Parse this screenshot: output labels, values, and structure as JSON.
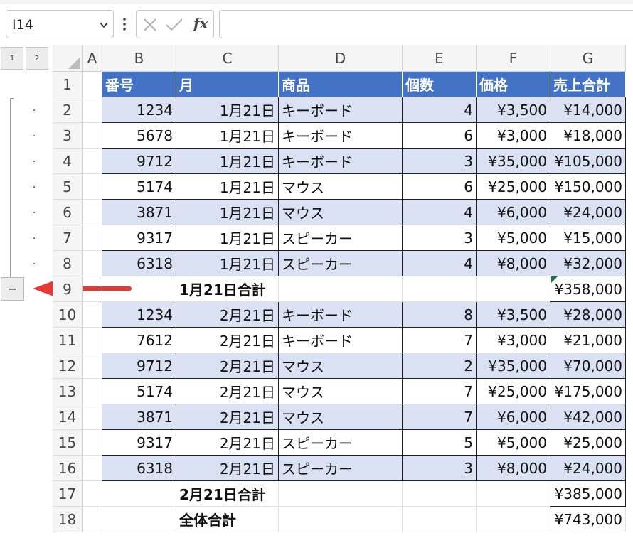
{
  "name_box": {
    "value": "I14"
  },
  "formula_bar": {
    "fx_label": "fx",
    "value": ""
  },
  "outline": {
    "level_buttons": [
      "1",
      "2"
    ],
    "collapse_symbol": "−"
  },
  "columns": [
    "A",
    "B",
    "C",
    "D",
    "E",
    "F",
    "G"
  ],
  "table": {
    "headers": [
      "番号",
      "月",
      "商品",
      "個数",
      "価格",
      "売上合計"
    ],
    "rows": [
      [
        "1234",
        "1月21日",
        "キーボード",
        "4",
        "¥3,500",
        "¥14,000"
      ],
      [
        "5678",
        "1月21日",
        "キーボード",
        "6",
        "¥3,000",
        "¥18,000"
      ],
      [
        "9712",
        "1月21日",
        "キーボード",
        "3",
        "¥35,000",
        "¥105,000"
      ],
      [
        "5174",
        "1月21日",
        "マウス",
        "6",
        "¥25,000",
        "¥150,000"
      ],
      [
        "3871",
        "1月21日",
        "マウス",
        "4",
        "¥6,000",
        "¥24,000"
      ],
      [
        "9317",
        "1月21日",
        "スピーカー",
        "3",
        "¥5,000",
        "¥15,000"
      ],
      [
        "6318",
        "1月21日",
        "スピーカー",
        "4",
        "¥8,000",
        "¥32,000"
      ],
      [
        "",
        "1月21日合計",
        "",
        "",
        "",
        "¥358,000"
      ],
      [
        "1234",
        "2月21日",
        "キーボード",
        "8",
        "¥3,500",
        "¥28,000"
      ],
      [
        "7612",
        "2月21日",
        "キーボード",
        "7",
        "¥3,000",
        "¥21,000"
      ],
      [
        "9712",
        "2月21日",
        "マウス",
        "2",
        "¥35,000",
        "¥70,000"
      ],
      [
        "5174",
        "2月21日",
        "マウス",
        "7",
        "¥25,000",
        "¥175,000"
      ],
      [
        "3871",
        "2月21日",
        "マウス",
        "7",
        "¥6,000",
        "¥42,000"
      ],
      [
        "9317",
        "2月21日",
        "スピーカー",
        "5",
        "¥5,000",
        "¥25,000"
      ],
      [
        "6318",
        "2月21日",
        "スピーカー",
        "3",
        "¥8,000",
        "¥24,000"
      ],
      [
        "",
        "2月21日合計",
        "",
        "",
        "",
        "¥385,000"
      ],
      [
        "",
        "全体合計",
        "",
        "",
        "",
        "¥743,000"
      ]
    ]
  },
  "row_numbers": [
    "1",
    "2",
    "3",
    "4",
    "5",
    "6",
    "7",
    "8",
    "9",
    "10",
    "11",
    "12",
    "13",
    "14",
    "15",
    "16",
    "17",
    "18"
  ],
  "colors": {
    "header_fill": "#4472c4",
    "band_fill": "#d9e1f2",
    "arrow": "#e53935"
  }
}
